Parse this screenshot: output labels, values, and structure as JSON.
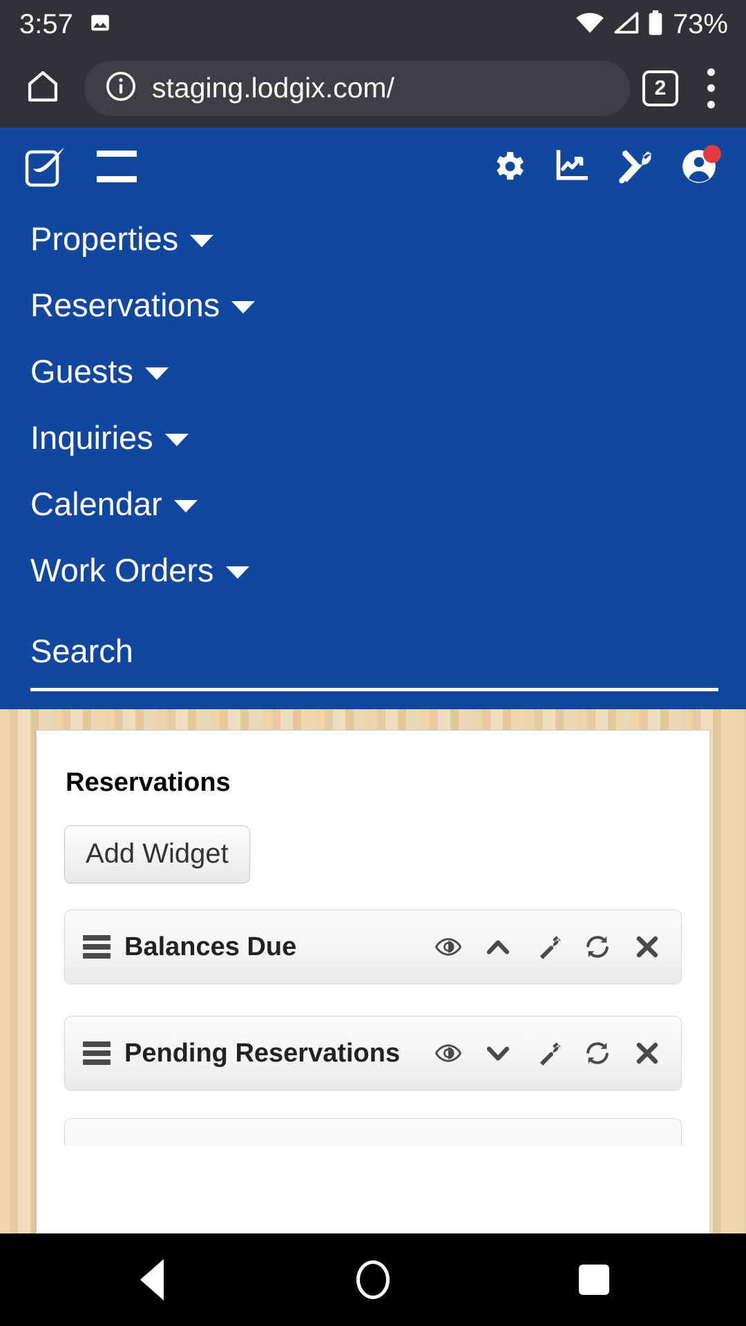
{
  "status_bar": {
    "clock": "3:57",
    "battery_percent": "73%",
    "icons": [
      "image-icon",
      "wifi-icon",
      "cell-signal-icon",
      "battery-icon"
    ]
  },
  "browser": {
    "home_icon": "home-icon",
    "site_info_icon": "info-circle-icon",
    "url": "staging.lodgix.com/",
    "tab_count": "2",
    "menu_icon": "kebab-menu-icon"
  },
  "app_header": {
    "logo_name": "lodgix-logo",
    "menu_toggle": "hamburger-menu-icon",
    "icons": [
      {
        "name": "gear-icon",
        "label": "Settings"
      },
      {
        "name": "chart-line-icon",
        "label": "Reports"
      },
      {
        "name": "tools-icon",
        "label": "Tools"
      },
      {
        "name": "user-avatar-icon",
        "label": "Account",
        "badge": true
      }
    ],
    "badge_color": "#e03a3f",
    "brand_color": "#11479f"
  },
  "nav": {
    "items": [
      {
        "label": "Properties",
        "caret": "caret-down-icon"
      },
      {
        "label": "Reservations",
        "caret": "caret-down-icon"
      },
      {
        "label": "Guests",
        "caret": "caret-down-icon"
      },
      {
        "label": "Inquiries",
        "caret": "caret-down-icon"
      },
      {
        "label": "Calendar",
        "caret": "caret-down-icon"
      },
      {
        "label": "Work Orders",
        "caret": "caret-down-icon"
      }
    ]
  },
  "search": {
    "label": "Search",
    "placeholder": "Search",
    "value": ""
  },
  "content": {
    "card_title": "Reservations",
    "add_widget_label": "Add Widget",
    "widgets": [
      {
        "title": "Balances Due",
        "handle_icon": "drag-handle-icon",
        "collapse_icon": "chevron-up-icon",
        "actions": [
          "eye-icon",
          "chevron-up-icon",
          "wrench-icon",
          "refresh-icon",
          "close-icon"
        ]
      },
      {
        "title": "Pending Reservations",
        "handle_icon": "drag-handle-icon",
        "collapse_icon": "chevron-down-icon",
        "actions": [
          "eye-icon",
          "chevron-down-icon",
          "wrench-icon",
          "refresh-icon",
          "close-icon"
        ]
      }
    ]
  },
  "android_nav": {
    "back": "back-triangle-icon",
    "home": "home-circle-icon",
    "recents": "recents-square-icon"
  }
}
